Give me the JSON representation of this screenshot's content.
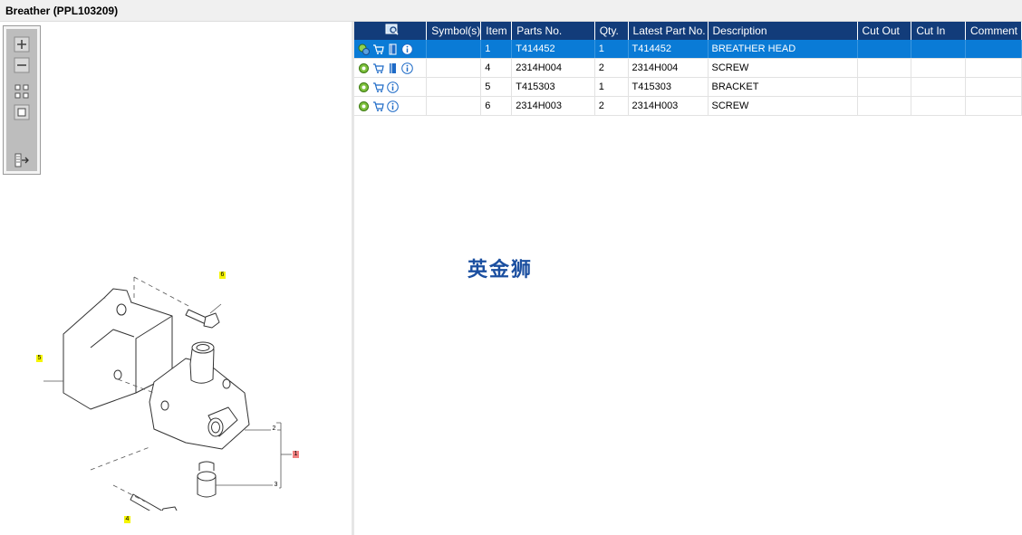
{
  "window": {
    "title": "Breather (PPL103209)"
  },
  "toolbar": {
    "buttons": [
      "zoom-in",
      "zoom-out",
      "fit-all",
      "actual-size",
      "export"
    ]
  },
  "drawing": {
    "callouts": [
      "6",
      "5",
      "2",
      "1",
      "3",
      "4"
    ]
  },
  "table": {
    "columns": [
      "",
      "Symbol(s)",
      "Item",
      "Parts No.",
      "Qty.",
      "Latest Part No.",
      "Description",
      "Cut Out",
      "Cut In",
      "Comment"
    ],
    "rows": [
      {
        "item": "1",
        "part_no": "T414452",
        "qty": "1",
        "latest_part_no": "T414452",
        "description": "BREATHER HEAD",
        "cut_out": "",
        "cut_in": "",
        "comment": "",
        "selected": true
      },
      {
        "item": "4",
        "part_no": "2314H004",
        "qty": "2",
        "latest_part_no": "2314H004",
        "description": "SCREW",
        "cut_out": "",
        "cut_in": "",
        "comment": "",
        "selected": false
      },
      {
        "item": "5",
        "part_no": "T415303",
        "qty": "1",
        "latest_part_no": "T415303",
        "description": "BRACKET",
        "cut_out": "",
        "cut_in": "",
        "comment": "",
        "selected": false
      },
      {
        "item": "6",
        "part_no": "2314H003",
        "qty": "2",
        "latest_part_no": "2314H003",
        "description": "SCREW",
        "cut_out": "",
        "cut_in": "",
        "comment": "",
        "selected": false
      }
    ]
  },
  "watermark": "英金狮",
  "colors": {
    "header": "#123c7a",
    "selected": "#0a7bd6",
    "callout": "#f5f500"
  }
}
